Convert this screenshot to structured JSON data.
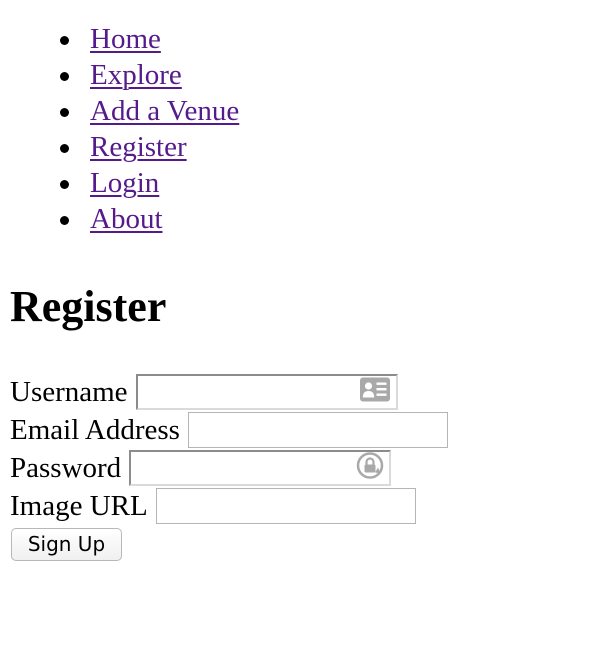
{
  "nav": {
    "items": [
      {
        "label": "Home"
      },
      {
        "label": "Explore"
      },
      {
        "label": "Add a Venue"
      },
      {
        "label": "Register"
      },
      {
        "label": "Login"
      },
      {
        "label": "About"
      }
    ]
  },
  "page": {
    "title": "Register"
  },
  "form": {
    "username_label": "Username",
    "username_value": "",
    "email_label": "Email Address",
    "email_value": "",
    "password_label": "Password",
    "password_value": "",
    "image_url_label": "Image URL",
    "image_url_value": "",
    "submit_label": "Sign Up"
  },
  "icons": {
    "username_autofill": "contact-card-icon",
    "password_autofill": "lock-icon"
  },
  "colors": {
    "link": "#551a8b",
    "text": "#000000"
  }
}
